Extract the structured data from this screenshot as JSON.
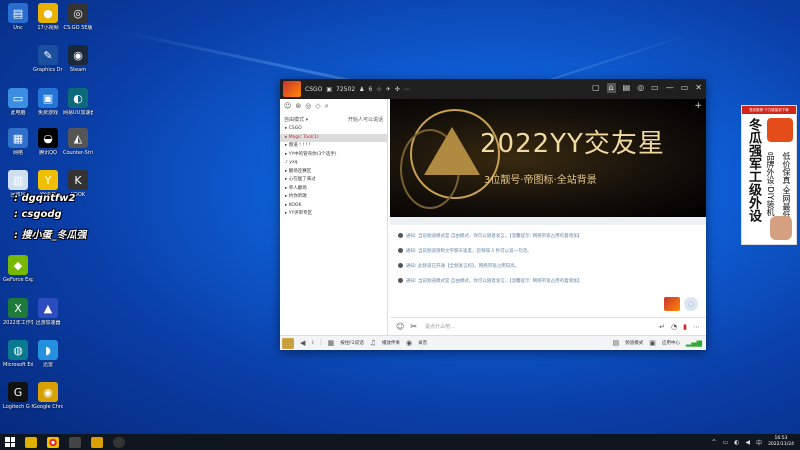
{
  "desktop": {
    "icons": [
      {
        "label": "Unc",
        "color": "#2a6fd0",
        "glyph": "▤"
      },
      {
        "label": "17小视频",
        "color": "#e8b100",
        "glyph": "●"
      },
      {
        "label": "CS:GO 5E版",
        "color": "#333",
        "glyph": "◎"
      },
      {
        "label": "Graphics Drivers",
        "color": "#1a4fa0",
        "glyph": "✎"
      },
      {
        "label": "Steam",
        "color": "#1b2838",
        "glyph": "◉"
      },
      {
        "label": "此电脑",
        "color": "#3b8ee0",
        "glyph": "▭"
      },
      {
        "label": "免费游戏",
        "color": "#2575d6",
        "glyph": "▣"
      },
      {
        "label": "网易UU加速器",
        "color": "#0c6a7a",
        "glyph": "◐"
      },
      {
        "label": "网络",
        "color": "#3070c8",
        "glyph": "▦"
      },
      {
        "label": "腾讯QQ",
        "color": "#000",
        "glyph": "◒"
      },
      {
        "label": "Counter-Strike",
        "color": "#555",
        "glyph": "◭"
      },
      {
        "label": "回收站",
        "color": "#d0e0f0",
        "glyph": "▥"
      },
      {
        "label": "YY语音",
        "color": "#f0c000",
        "glyph": "Y"
      },
      {
        "label": "KOOK",
        "color": "#333",
        "glyph": "K"
      },
      {
        "label": "GeForce Experience",
        "color": "#76b900",
        "glyph": "◆"
      },
      {
        "label": "2022年工作表",
        "color": "#1d7a3a",
        "glyph": "X"
      },
      {
        "label": "迅游加速器",
        "color": "#2c4cc0",
        "glyph": "▲"
      },
      {
        "label": "Microsoft Edge",
        "color": "#0a7a90",
        "glyph": "◍"
      },
      {
        "label": "迅雷",
        "color": "#2490e0",
        "glyph": "◗"
      },
      {
        "label": "Logitech G HUB",
        "color": "#111",
        "glyph": "G"
      },
      {
        "label": "Google Chrome",
        "color": "#d8a000",
        "glyph": "◉"
      }
    ],
    "overlay_lines": [
      ": dgqntfw2",
      ": csgodg",
      ": 搜小蛋_冬瓜强"
    ]
  },
  "app_window": {
    "channel_name": "CSGO",
    "channel_id": "72502",
    "online_count": "6",
    "title_icons": [
      "☆",
      "✈",
      "✣",
      "⋯"
    ],
    "window_icons": [
      "▢",
      "⌂",
      "▤",
      "◎",
      "▭",
      "—",
      "▭",
      "✕"
    ],
    "left_tools": [
      "☺",
      "⊛",
      "◎",
      "◇",
      "⌕"
    ],
    "mode_label": "自由模式 ▾",
    "mode_right": "开始人可以说话",
    "channels": [
      {
        "text": "▸ CSGO",
        "active": false
      },
      {
        "text": "▸ Magic Tool(1)",
        "active": true
      },
      {
        "text": "▸ 频道 ! ! ! !",
        "active": false
      },
      {
        "text": "▸ YY中的管弯你(3个选手)",
        "active": false
      },
      {
        "text": "    ♪ yxq",
        "active": false
      },
      {
        "text": "▸ 翻场连赛区",
        "active": false
      },
      {
        "text": "▸ 心在瘦了来过",
        "active": false
      },
      {
        "text": "▸ 单人翻场",
        "active": false
      },
      {
        "text": "▸ 约你听歌",
        "active": false
      },
      {
        "text": "▸ KOOK",
        "active": false
      },
      {
        "text": "▸ YY评审专区",
        "active": false
      }
    ],
    "banner": {
      "headline": "2022YY交友星",
      "subline": "3位靓号·帝图标·全站背景"
    },
    "messages": [
      "通知: 当前频道模式是 自由模式，你可以随意发言。【温馨提示: 网络带宽占用有着增加】",
      "通知: 当前频道限制文字聊天速度，您每隔 5 秒可以说一句话。",
      "通知: 此频道已开通【全频发言权】，网络带宽占用较高。",
      "通知: 当前频道模式是 自由模式，你可以随意发言。【温馨提示: 网络带宽占用有着增加】"
    ],
    "input_placeholder": "说点什么吧...",
    "bottom_items": {
      "push_to_talk": "按住F2说话",
      "play_music": "播放伴奏",
      "record": "录音",
      "mode": "频道模式",
      "app_center": "应用中心"
    }
  },
  "ad": {
    "header": "首页推荐·下方链接到下单",
    "col1": "冬瓜强军工级外设",
    "col2": "品牌外设·DIY装机",
    "col3": "低价保真·全网最低"
  },
  "taskbar": {
    "time": "16:53",
    "date": "2022/11/24",
    "tray_icons": [
      "^",
      "▭",
      "◐",
      "◀",
      "中"
    ]
  }
}
